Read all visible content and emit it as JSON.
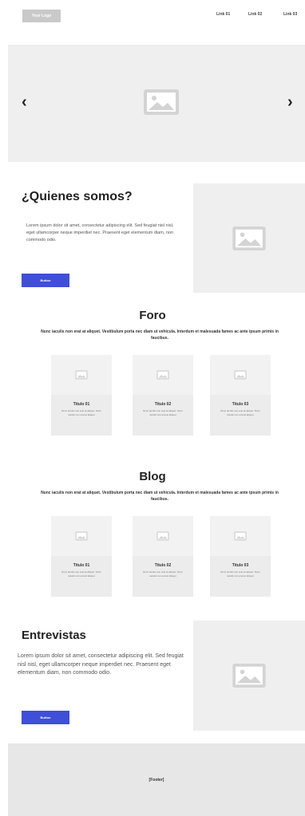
{
  "header": {
    "logo": "Your Logo",
    "links": [
      "Link 01",
      "Link 02",
      "Link 03"
    ]
  },
  "hero": {
    "prev_icon": "‹",
    "next_icon": "›",
    "image_icon": "image-icon"
  },
  "about": {
    "title": "¿Quienes somos?",
    "text": "Lorem ipsum dolor sit amet, consectetur adipiscing elit. Sed feugiat nisl nisl, eget ullamcorper neque imperdiet nec. Praesent eget elementum diam, non commodo odio.",
    "button": "Button"
  },
  "foro": {
    "title": "Foro",
    "subtitle": "Nunc iaculis non erat at aliquet. Vestibulum porta nec diam ut vehicula. Interdum et malesuada fames ac ante ipsum primis in faucibus.",
    "cards": [
      {
        "title": "Titulo 01",
        "text": "Nunc iaculis non erat at aliquet. Nunc iaculis non erat at aliquet"
      },
      {
        "title": "Titulo 02",
        "text": "Nunc iaculis non erat at aliquet. Nunc iaculis non erat at aliquet"
      },
      {
        "title": "Titulo 03",
        "text": "Nunc iaculis non erat at aliquet. Nunc iaculis non erat at aliquet"
      }
    ]
  },
  "blog": {
    "title": "Blog",
    "subtitle": "Nunc iaculis non erat at aliquet. Vestibulum porta nec diam ut vehicula. Interdum et malesuada fames ac ante ipsum primis in faucibus.",
    "cards": [
      {
        "title": "Titulo 01",
        "text": "Nunc iaculis non erat at aliquet. Nunc iaculis non erat at aliquet"
      },
      {
        "title": "Titulo 02",
        "text": "Nunc iaculis non erat at aliquet. Nunc iaculis non erat at aliquet"
      },
      {
        "title": "Titulo 03",
        "text": "Nunc iaculis non erat at aliquet. Nunc iaculis non erat at aliquet"
      }
    ]
  },
  "entrevistas": {
    "title": "Entrevistas",
    "text": "Lorem ipsum dolor sit amet, consectetur adipiscing elit. Sed feugiat nisl nisl, eget ullamcorper neque imperdiet nec. Praesent eget elementum diam, non commodo odio.",
    "button": "Button"
  },
  "footer": {
    "label": "[Footer]"
  },
  "colors": {
    "button": "#3f4fd8",
    "placeholder_bg": "#efefef"
  }
}
